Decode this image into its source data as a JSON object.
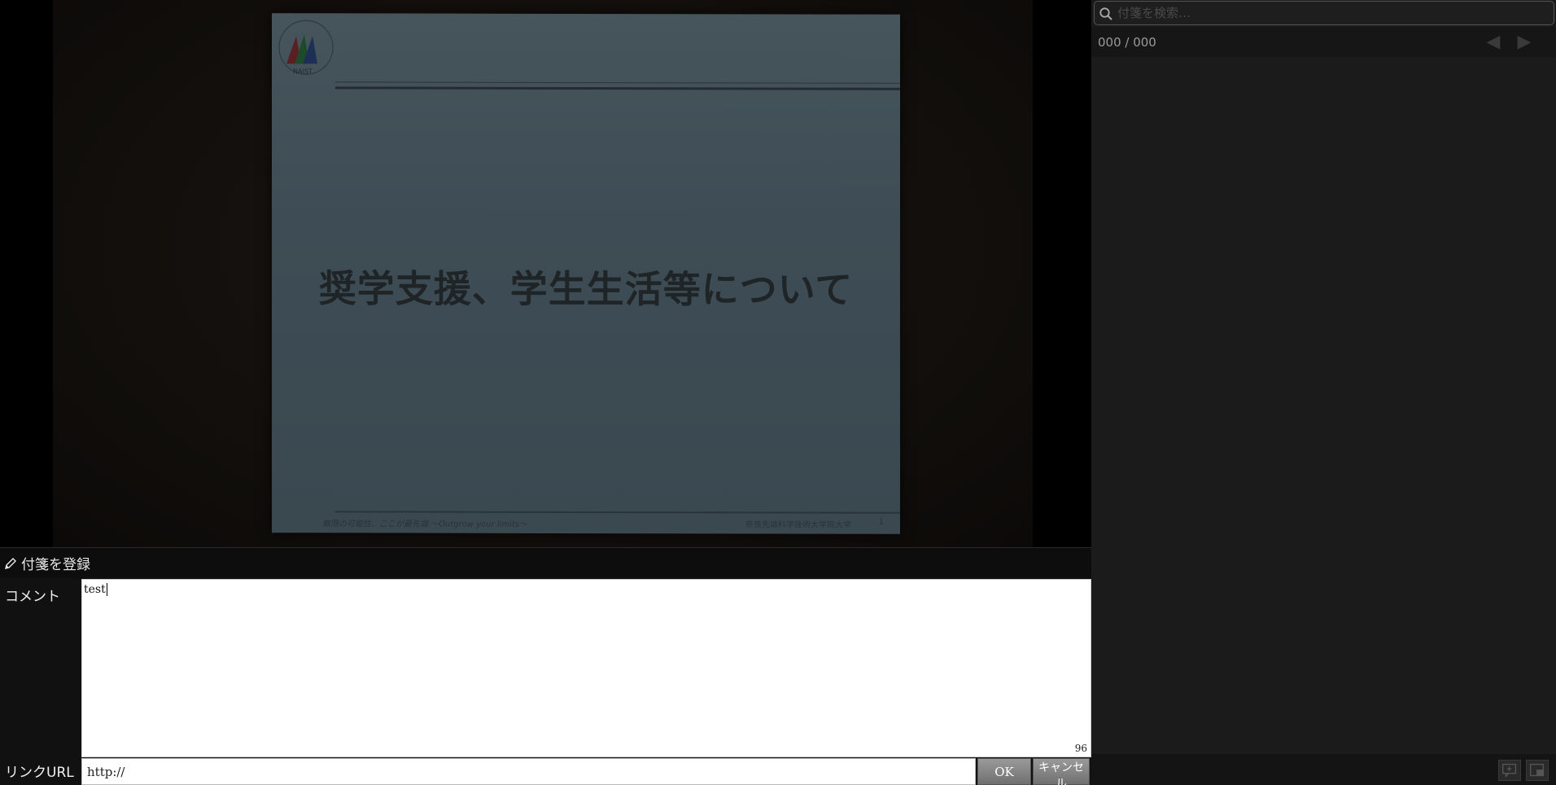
{
  "slide": {
    "logo_text": "NAIST",
    "title": "奨学支援、学生生活等について",
    "footer_left": "無限の可能性、ここが最先端 〜Outgrow your limits〜",
    "footer_right": "奈良先端科学技術大学院大学",
    "page_number": "1"
  },
  "register": {
    "label": "付箋を登録",
    "icon": "pencil-icon"
  },
  "form": {
    "comment_label": "コメント",
    "comment_value": "test",
    "char_count": "96",
    "url_label": "リンクURL",
    "url_value": "http://",
    "ok_label": "OK",
    "cancel_label": "キャンセル"
  },
  "sidebar": {
    "search_placeholder": "付箋を検索…",
    "search_icon": "search-icon",
    "counter": "000 / 000",
    "prev_icon": "◀",
    "next_icon": "▶"
  },
  "colors": {
    "panel_bg": "#1a1a1a",
    "form_bg": "#111111",
    "button_gray": "#808080"
  }
}
